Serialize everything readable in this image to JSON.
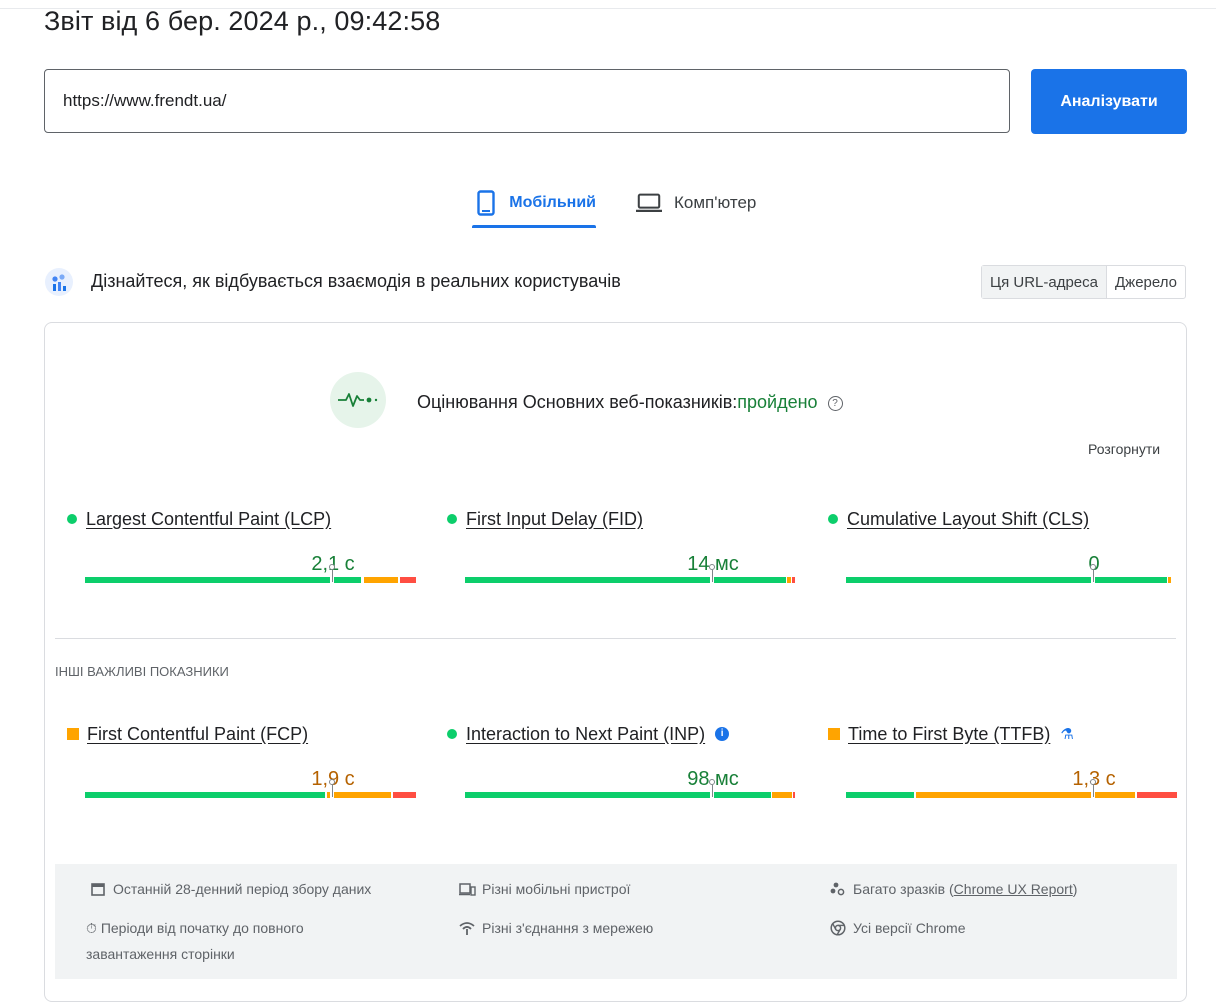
{
  "report_title": "Звіт від 6 бер. 2024 р., 09:42:58",
  "url_input": {
    "value": "https://www.frendt.ua/"
  },
  "analyze_button": "Аналізувати",
  "tabs": {
    "mobile": "Мобільний",
    "desktop": "Комп'ютер",
    "active": "mobile"
  },
  "field_data": {
    "title": "Дізнайтеся, як відбувається взаємодія в реальних користувачів",
    "toggle": [
      "Ця URL-адреса",
      "Джерело"
    ]
  },
  "assessment": {
    "label": "Оцінювання Основних веб-показників:",
    "result": "пройдено",
    "expand": "Розгорнути"
  },
  "core_metrics": [
    {
      "name": "Largest Contentful Paint (LCP)",
      "value": "2,1 с",
      "status": "good"
    },
    {
      "name": "First Input Delay (FID)",
      "value": "14 мс",
      "status": "good"
    },
    {
      "name": "Cumulative Layout Shift (CLS)",
      "value": "0",
      "status": "good"
    }
  ],
  "other_heading": "ІНШІ ВАЖЛИВІ ПОКАЗНИКИ",
  "other_metrics": [
    {
      "name": "First Contentful Paint (FCP)",
      "value": "1,9 с",
      "status": "average"
    },
    {
      "name": "Interaction to Next Paint (INP)",
      "value": "98 мс",
      "status": "good"
    },
    {
      "name": "Time to First Byte (TTFB)",
      "value": "1,3 с",
      "status": "average"
    }
  ],
  "info": {
    "period": "Останній 28-денний період збору даних",
    "devices": "Різні мобільні пристрої",
    "samples_prefix": "Багато зразків (",
    "samples_link": "Chrome UX Report",
    "samples_suffix": ")",
    "durations": "Періоди від початку до повного завантаження сторінки",
    "connections": "Різні з'єднання з мережею",
    "chrome": "Усі версії Chrome"
  },
  "colors": {
    "good": "#0cce6b",
    "average": "#ffa400",
    "poor": "#ff4e42",
    "accent": "#1a73e8"
  }
}
